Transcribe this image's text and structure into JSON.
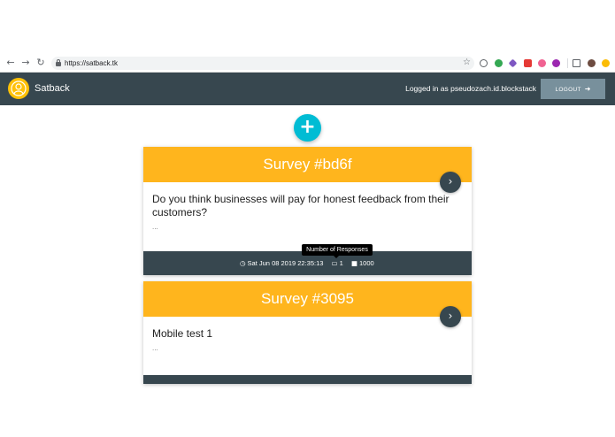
{
  "browser": {
    "url": "https://satback.tk",
    "back_icon": "arrow-left-icon",
    "forward_icon": "arrow-right-icon",
    "reload_icon": "reload-icon",
    "bookmark_icon": "star-icon",
    "extension_colors": [
      "#5f6368",
      "#34a853",
      "#7e57c2",
      "#e53935",
      "#f06292",
      "#9c27b0",
      "#5f6368",
      "#6d4c41",
      "#fbbc05"
    ]
  },
  "app": {
    "name": "Satback",
    "logo_color": "#ffc107",
    "header_color": "#37474f",
    "login_status": "Logged in as pseudozach.id.blockstack",
    "logout_label": "LOGOUT",
    "logout_icon": "sign-out-icon"
  },
  "fab": {
    "icon": "plus-icon",
    "color": "#00bcd4",
    "label": "+"
  },
  "surveys": [
    {
      "title": "Survey #bd6f",
      "question": "Do you think businesses will pay for honest feedback from their customers?",
      "excerpt": "...",
      "date": "Sat Jun 08 2019 22:35:13",
      "responses": "1",
      "budget": "1000"
    },
    {
      "title": "Survey #3095",
      "question": "Mobile test 1",
      "excerpt": "...",
      "date": "",
      "responses": "",
      "budget": ""
    }
  ],
  "tooltip": {
    "text": "Number of Responses"
  },
  "colors": {
    "card_header": "#ffb51d",
    "card_footer": "#37474f",
    "logout_button": "#78909c"
  }
}
